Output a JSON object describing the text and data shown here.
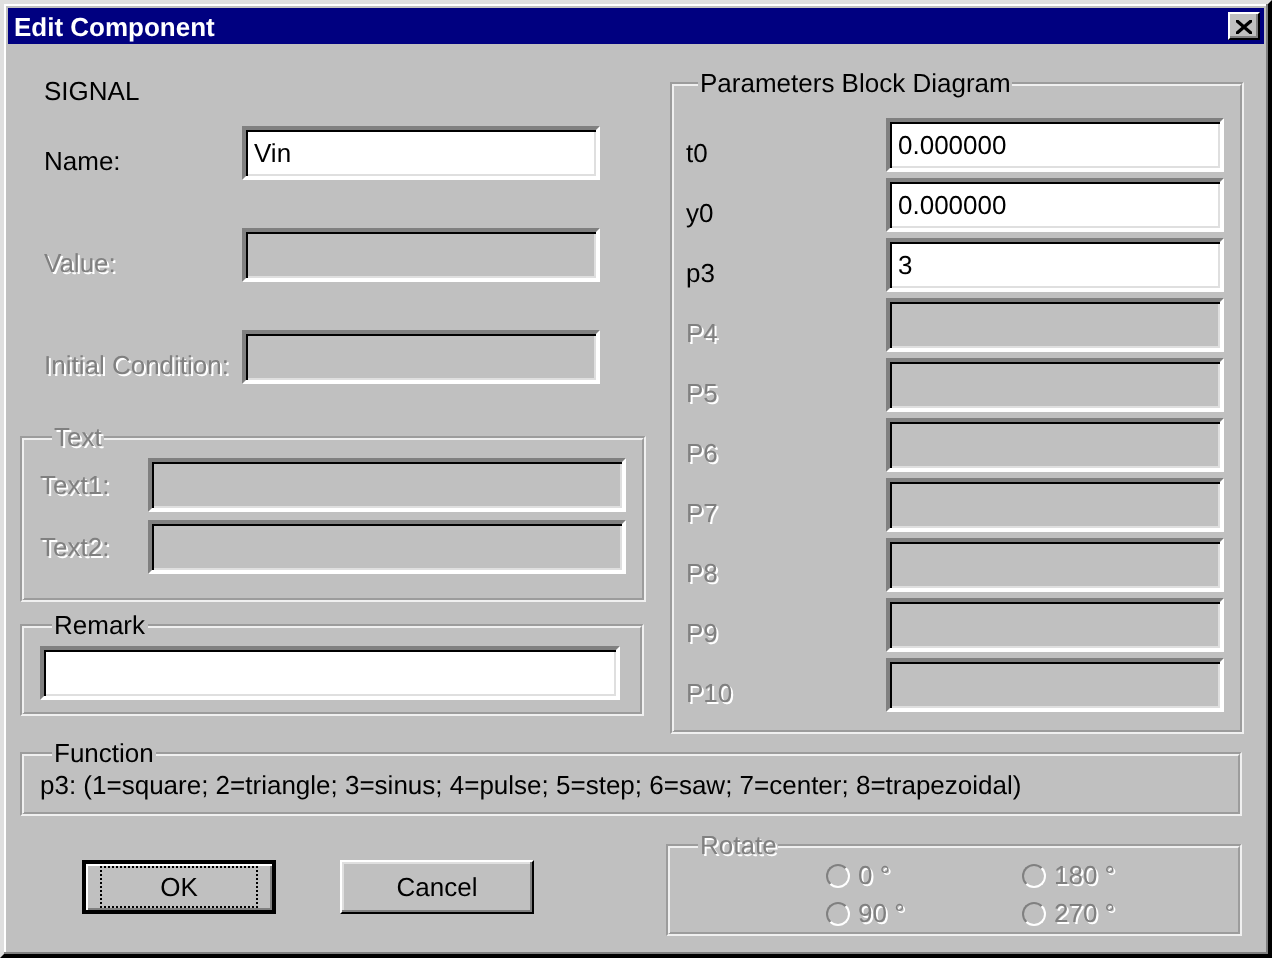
{
  "window": {
    "title": "Edit Component"
  },
  "section_title": "SIGNAL",
  "fields": [
    {
      "label": "Name:",
      "value": "Vin",
      "disabled": false
    },
    {
      "label": "Value:",
      "disabled": true
    },
    {
      "label": "Initial Condition:",
      "disabled": true
    }
  ],
  "text_group": {
    "title": "Text",
    "disabled": true,
    "fields": [
      {
        "label": "Text1:"
      },
      {
        "label": "Text2:"
      }
    ]
  },
  "remark": {
    "title": "Remark",
    "disabled": false
  },
  "parameters": {
    "title": "Parameters Block Diagram",
    "fields": [
      {
        "label": "t0",
        "value": "0.000000",
        "disabled": false
      },
      {
        "label": "y0",
        "value": "0.000000",
        "disabled": false
      },
      {
        "label": "p3",
        "value": "3",
        "disabled": false
      },
      {
        "label": "P4",
        "disabled": true
      },
      {
        "label": "P5",
        "disabled": true
      },
      {
        "label": "P6",
        "disabled": true
      },
      {
        "label": "P7",
        "disabled": true
      },
      {
        "label": "P8",
        "disabled": true
      },
      {
        "label": "P9",
        "disabled": true
      },
      {
        "label": "P10",
        "disabled": true
      }
    ]
  },
  "function": {
    "title": "Function",
    "text": "p3: (1=square; 2=triangle; 3=sinus; 4=pulse; 5=step; 6=saw; 7=center; 8=trapezoidal)"
  },
  "buttons": [
    {
      "label": "OK",
      "focused": true
    },
    {
      "label": "Cancel",
      "focused": false
    }
  ],
  "rotate": {
    "title": "Rotate",
    "disabled": true,
    "options": [
      {
        "label": "0 °",
        "selected": false
      },
      {
        "label": "180 °",
        "selected": false
      },
      {
        "label": "90 °",
        "selected": false
      },
      {
        "label": "270 °",
        "selected": false
      }
    ]
  }
}
